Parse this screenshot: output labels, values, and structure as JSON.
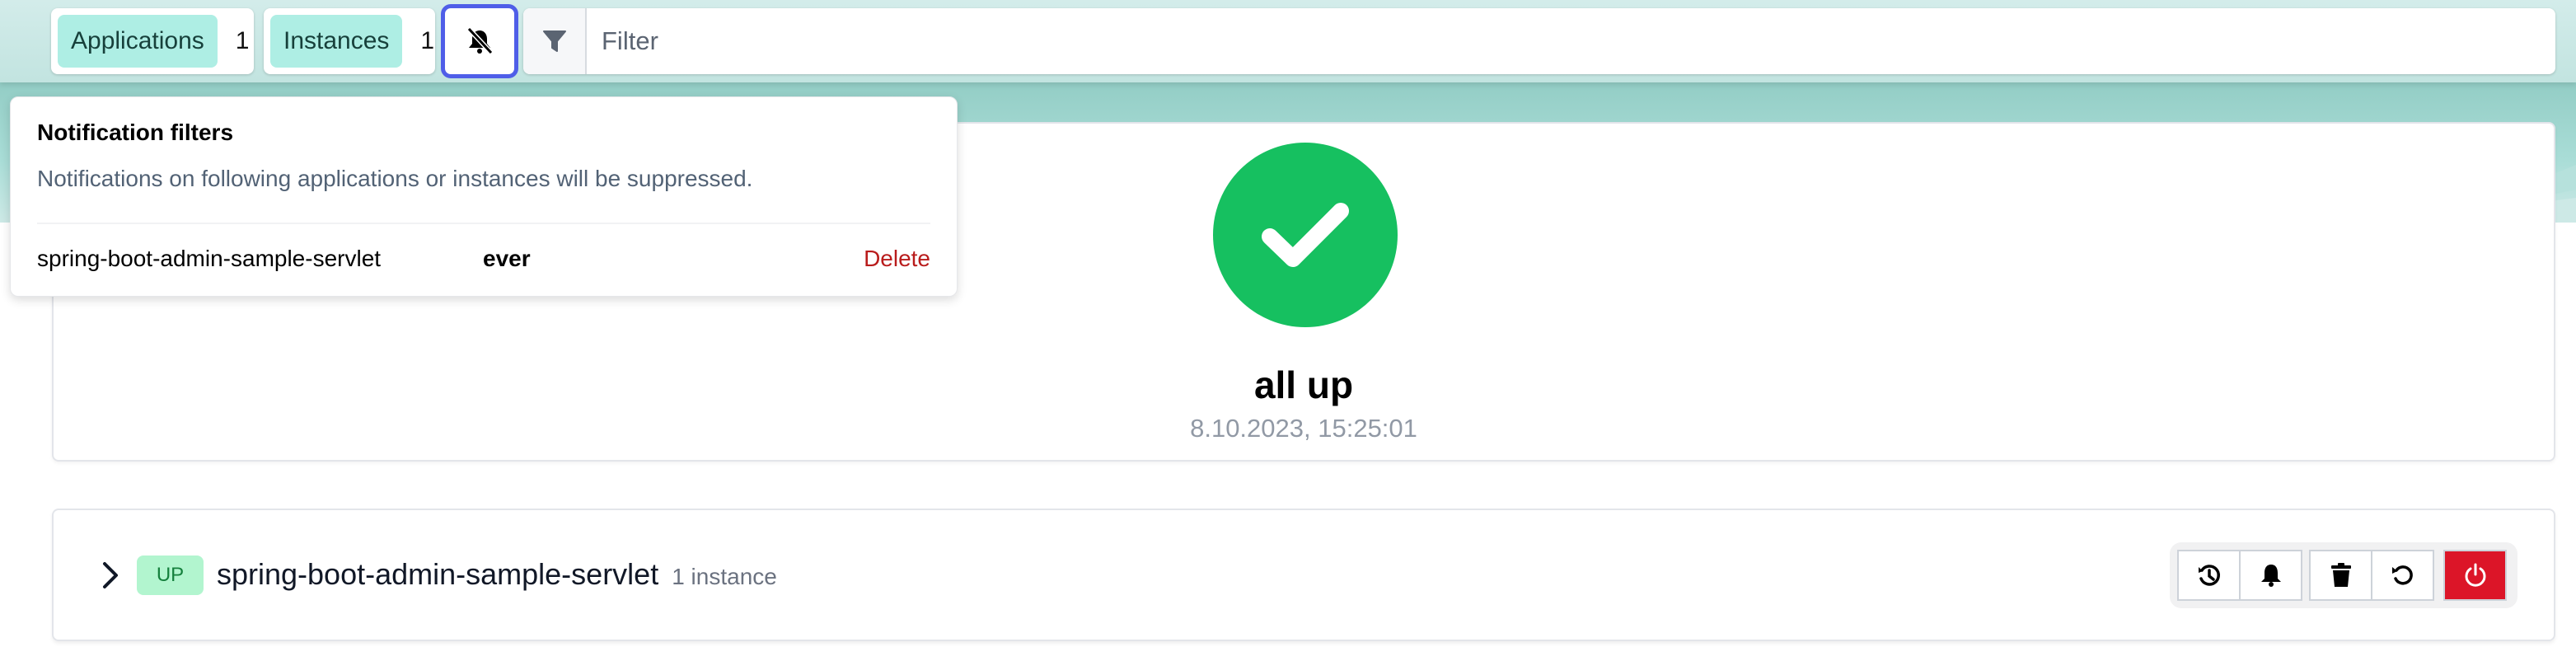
{
  "toolbar": {
    "applications": {
      "label": "Applications",
      "count": "1"
    },
    "instances": {
      "label": "Instances",
      "count": "1"
    },
    "mute_button_icon": "bell-slash-icon",
    "filter_icon": "funnel-icon",
    "search": {
      "value": "",
      "placeholder": "Filter"
    }
  },
  "notification_popover": {
    "title": "Notification filters",
    "description": "Notifications on following applications or instances will be suppressed.",
    "filters": [
      {
        "name": "spring-boot-admin-sample-servlet",
        "until": "ever",
        "action": "Delete"
      }
    ]
  },
  "status_summary": {
    "icon": "check-circle-icon",
    "title": "all up",
    "timestamp": "8.10.2023, 15:25:01",
    "color": "#16c060"
  },
  "applications": [
    {
      "status": "UP",
      "name": "spring-boot-admin-sample-servlet",
      "instances_label": "1 instance",
      "actions": [
        {
          "name": "journal",
          "icon": "history-icon"
        },
        {
          "name": "notifications",
          "icon": "bell-icon"
        },
        {
          "name": "unregister",
          "icon": "trash-icon"
        },
        {
          "name": "refresh",
          "icon": "refresh-icon"
        },
        {
          "name": "shutdown",
          "icon": "power-icon",
          "color": "#dc1528"
        }
      ]
    }
  ],
  "colors": {
    "accent_blue": "#4f5ee8",
    "danger": "#dc1528",
    "up_badge_bg": "#b2f5cf",
    "teal": "#aeeee4"
  }
}
